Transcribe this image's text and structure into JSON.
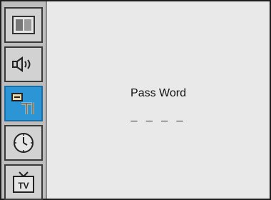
{
  "menu": {
    "tabs": [
      {
        "name": "picture",
        "icon": "picture-icon",
        "active": false
      },
      {
        "name": "sound",
        "icon": "speaker-icon",
        "active": false
      },
      {
        "name": "setup",
        "icon": "tools-icon",
        "active": true
      },
      {
        "name": "timer",
        "icon": "clock-icon",
        "active": false
      },
      {
        "name": "tv",
        "icon": "tv-icon",
        "active": false
      }
    ]
  },
  "password": {
    "label": "Pass Word",
    "entry": "_ _ _ _"
  },
  "colors": {
    "active_tab": "#2b95d6",
    "sidebar_bg": "#bdbdbd",
    "content_bg": "#e9e9e9"
  }
}
